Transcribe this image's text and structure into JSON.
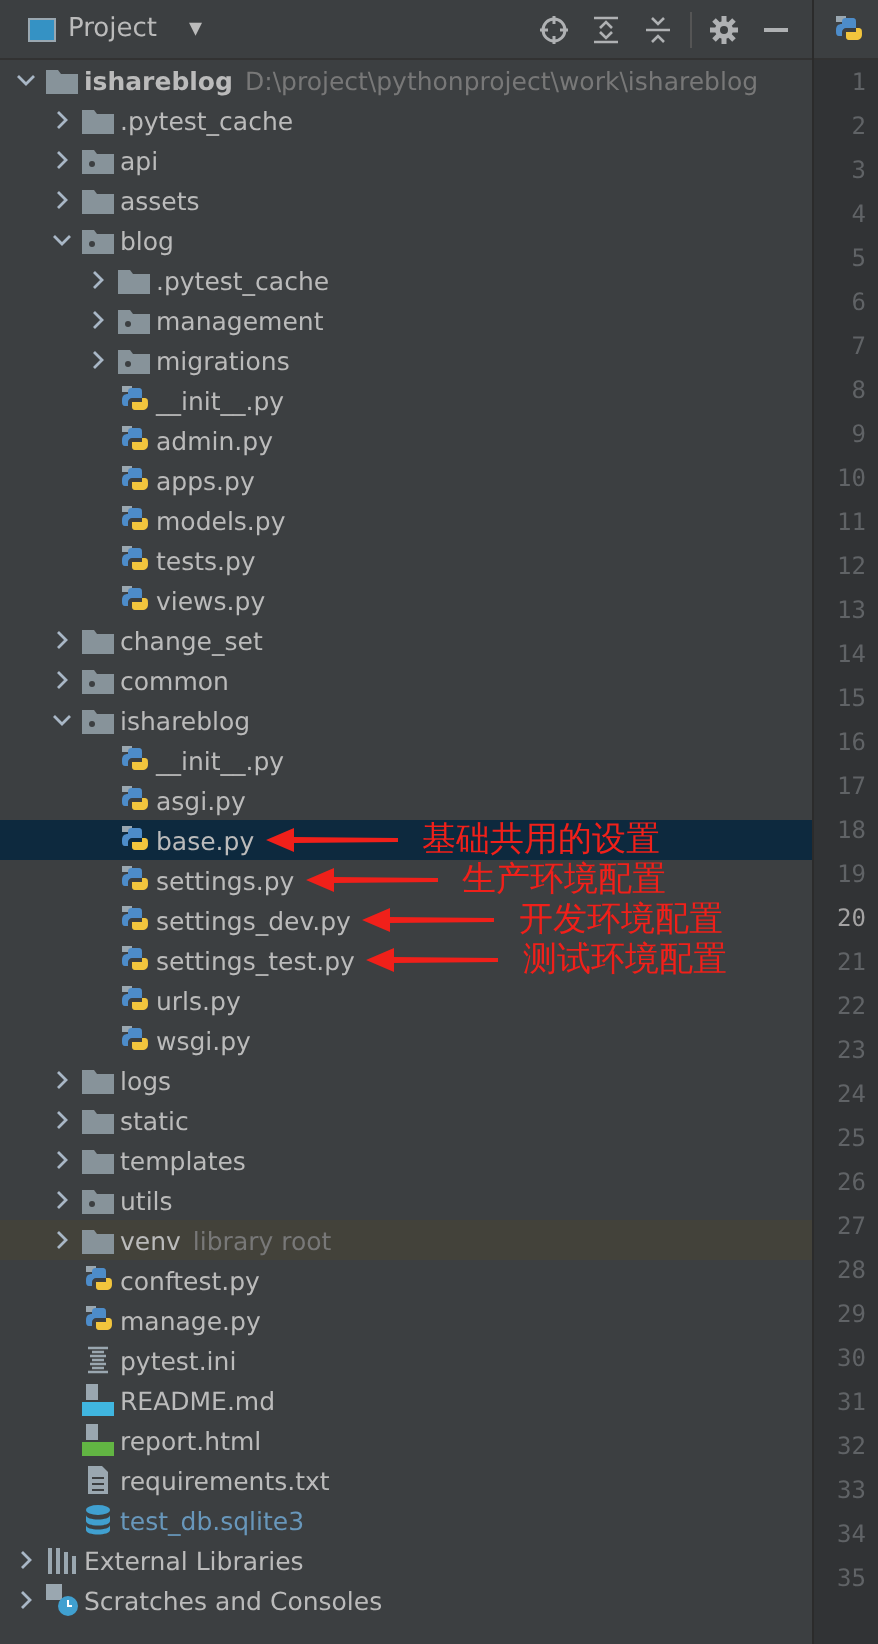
{
  "header": {
    "title": "Project",
    "dropdown": "▾"
  },
  "tree": [
    {
      "name": "ishareblog",
      "kind": "root",
      "note": "D:\\project\\pythonproject\\work\\ishareblog",
      "expanded": true,
      "selected": false,
      "children": [
        {
          "name": ".pytest_cache",
          "kind": "folder",
          "expanded": false,
          "selected": false
        },
        {
          "name": "api",
          "kind": "package",
          "expanded": false,
          "selected": false
        },
        {
          "name": "assets",
          "kind": "folder",
          "expanded": false,
          "selected": false
        },
        {
          "name": "blog",
          "kind": "package",
          "expanded": true,
          "selected": false,
          "children": [
            {
              "name": ".pytest_cache",
              "kind": "folder",
              "expanded": false,
              "selected": false
            },
            {
              "name": "management",
              "kind": "package",
              "expanded": false,
              "selected": false
            },
            {
              "name": "migrations",
              "kind": "package",
              "expanded": false,
              "selected": false
            },
            {
              "name": "__init__.py",
              "kind": "python",
              "selected": false
            },
            {
              "name": "admin.py",
              "kind": "python",
              "selected": false
            },
            {
              "name": "apps.py",
              "kind": "python",
              "selected": false
            },
            {
              "name": "models.py",
              "kind": "python",
              "selected": false
            },
            {
              "name": "tests.py",
              "kind": "python",
              "selected": false
            },
            {
              "name": "views.py",
              "kind": "python",
              "selected": false
            }
          ]
        },
        {
          "name": "change_set",
          "kind": "folder",
          "expanded": false,
          "selected": false
        },
        {
          "name": "common",
          "kind": "package",
          "expanded": false,
          "selected": false
        },
        {
          "name": "ishareblog",
          "kind": "package",
          "expanded": true,
          "selected": false,
          "children": [
            {
              "name": "__init__.py",
              "kind": "python",
              "selected": false
            },
            {
              "name": "asgi.py",
              "kind": "python",
              "selected": false
            },
            {
              "name": "base.py",
              "kind": "python",
              "selected": true,
              "annotation": "基础共用的设置"
            },
            {
              "name": "settings.py",
              "kind": "python",
              "selected": false,
              "annotation": "生产环境配置"
            },
            {
              "name": "settings_dev.py",
              "kind": "python",
              "selected": false,
              "annotation": "开发环境配置"
            },
            {
              "name": "settings_test.py",
              "kind": "python",
              "selected": false,
              "annotation": "测试环境配置"
            },
            {
              "name": "urls.py",
              "kind": "python",
              "selected": false
            },
            {
              "name": "wsgi.py",
              "kind": "python",
              "selected": false
            }
          ]
        },
        {
          "name": "logs",
          "kind": "folder",
          "expanded": false,
          "selected": false
        },
        {
          "name": "static",
          "kind": "folder",
          "expanded": false,
          "selected": false
        },
        {
          "name": "templates",
          "kind": "folder",
          "expanded": false,
          "selected": false
        },
        {
          "name": "utils",
          "kind": "package",
          "expanded": false,
          "selected": false
        },
        {
          "name": "venv",
          "kind": "folder",
          "note": "library root",
          "library_root": true,
          "expanded": false,
          "selected": false
        },
        {
          "name": "conftest.py",
          "kind": "python",
          "selected": false
        },
        {
          "name": "manage.py",
          "kind": "python",
          "selected": false
        },
        {
          "name": "pytest.ini",
          "kind": "ini",
          "selected": false
        },
        {
          "name": "README.md",
          "kind": "md",
          "selected": false
        },
        {
          "name": "report.html",
          "kind": "html",
          "selected": false
        },
        {
          "name": "requirements.txt",
          "kind": "txt",
          "selected": false
        },
        {
          "name": "test_db.sqlite3",
          "kind": "sqlite",
          "selected": false
        }
      ]
    },
    {
      "name": "External Libraries",
      "kind": "libraries",
      "expanded": false,
      "selected": false
    },
    {
      "name": "Scratches and Consoles",
      "kind": "scratches",
      "expanded": false,
      "selected": false
    }
  ],
  "line_numbers": [
    {
      "number": "1",
      "current": false
    },
    {
      "number": "2",
      "current": false
    },
    {
      "number": "3",
      "current": false
    },
    {
      "number": "4",
      "current": false
    },
    {
      "number": "5",
      "current": false
    },
    {
      "number": "6",
      "current": false
    },
    {
      "number": "7",
      "current": false
    },
    {
      "number": "8",
      "current": false
    },
    {
      "number": "9",
      "current": false
    },
    {
      "number": "10",
      "current": false
    },
    {
      "number": "11",
      "current": false
    },
    {
      "number": "12",
      "current": false
    },
    {
      "number": "13",
      "current": false
    },
    {
      "number": "14",
      "current": false
    },
    {
      "number": "15",
      "current": false
    },
    {
      "number": "16",
      "current": false
    },
    {
      "number": "17",
      "current": false
    },
    {
      "number": "18",
      "current": false
    },
    {
      "number": "19",
      "current": false
    },
    {
      "number": "20",
      "current": true
    },
    {
      "number": "21",
      "current": false
    },
    {
      "number": "22",
      "current": false
    },
    {
      "number": "23",
      "current": false
    },
    {
      "number": "24",
      "current": false
    },
    {
      "number": "25",
      "current": false
    },
    {
      "number": "26",
      "current": false
    },
    {
      "number": "27",
      "current": false
    },
    {
      "number": "28",
      "current": false
    },
    {
      "number": "29",
      "current": false
    },
    {
      "number": "30",
      "current": false
    },
    {
      "number": "31",
      "current": false
    },
    {
      "number": "32",
      "current": false
    },
    {
      "number": "33",
      "current": false
    },
    {
      "number": "34",
      "current": false
    },
    {
      "number": "35",
      "current": false
    }
  ]
}
